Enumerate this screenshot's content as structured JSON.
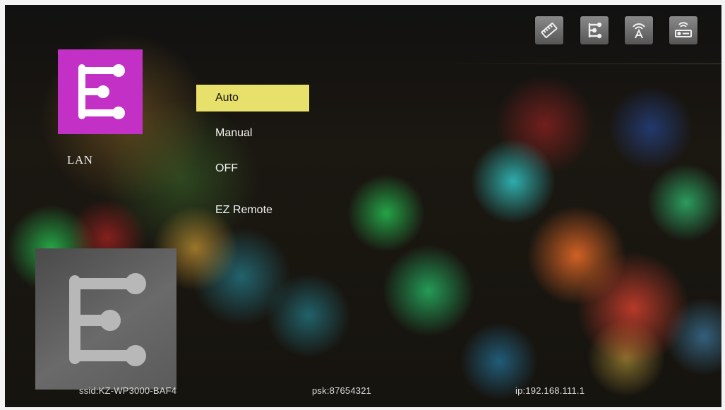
{
  "app": {
    "label": "LAN",
    "icon": "ez-cast-logo-icon",
    "tile_color": "#c330c6"
  },
  "status_icons": [
    {
      "name": "network-icon"
    },
    {
      "name": "ez-cast-mode-icon"
    },
    {
      "name": "wifi-antenna-icon"
    },
    {
      "name": "router-icon"
    }
  ],
  "menu": {
    "items": [
      {
        "label": "Auto",
        "selected": true
      },
      {
        "label": "Manual",
        "selected": false
      },
      {
        "label": "OFF",
        "selected": false
      },
      {
        "label": "EZ Remote",
        "selected": false
      }
    ],
    "highlight_color": "#e7e06a"
  },
  "preview": {
    "icon": "ez-cast-logo-icon"
  },
  "info_bar": {
    "ssid": "ssid:KZ-WP3000-BAF4",
    "psk": "psk:87654321",
    "ip": "ip:192.168.111.1"
  }
}
